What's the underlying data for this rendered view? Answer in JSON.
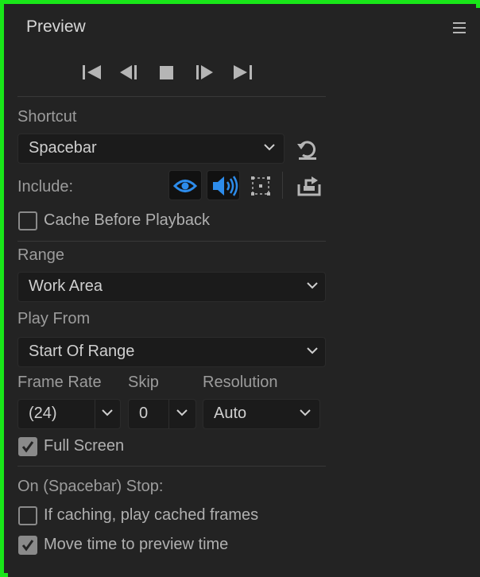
{
  "panel": {
    "title": "Preview"
  },
  "colors": {
    "accent_blue": "#2d8ceb",
    "frame_green": "#19e619"
  },
  "transport": {
    "icons": [
      "first-frame-icon",
      "previous-frame-icon",
      "stop-icon",
      "next-frame-icon",
      "last-frame-icon"
    ]
  },
  "shortcut": {
    "label": "Shortcut",
    "value": "Spacebar"
  },
  "include": {
    "label": "Include:",
    "video_on": true,
    "audio_on": true,
    "overlays_on": false
  },
  "cache_before_playback": {
    "label": "Cache Before Playback",
    "checked": false
  },
  "range": {
    "label": "Range",
    "value": "Work Area"
  },
  "play_from": {
    "label": "Play From",
    "value": "Start Of Range"
  },
  "frame_rate": {
    "label": "Frame Rate",
    "value": "(24)"
  },
  "skip": {
    "label": "Skip",
    "value": "0"
  },
  "resolution": {
    "label": "Resolution",
    "value": "Auto"
  },
  "full_screen": {
    "label": "Full Screen",
    "checked": true
  },
  "on_stop": {
    "label": "On (Spacebar) Stop:",
    "play_cached": {
      "label": "If caching, play cached frames",
      "checked": false
    },
    "move_time": {
      "label": "Move time to preview time",
      "checked": true
    }
  }
}
